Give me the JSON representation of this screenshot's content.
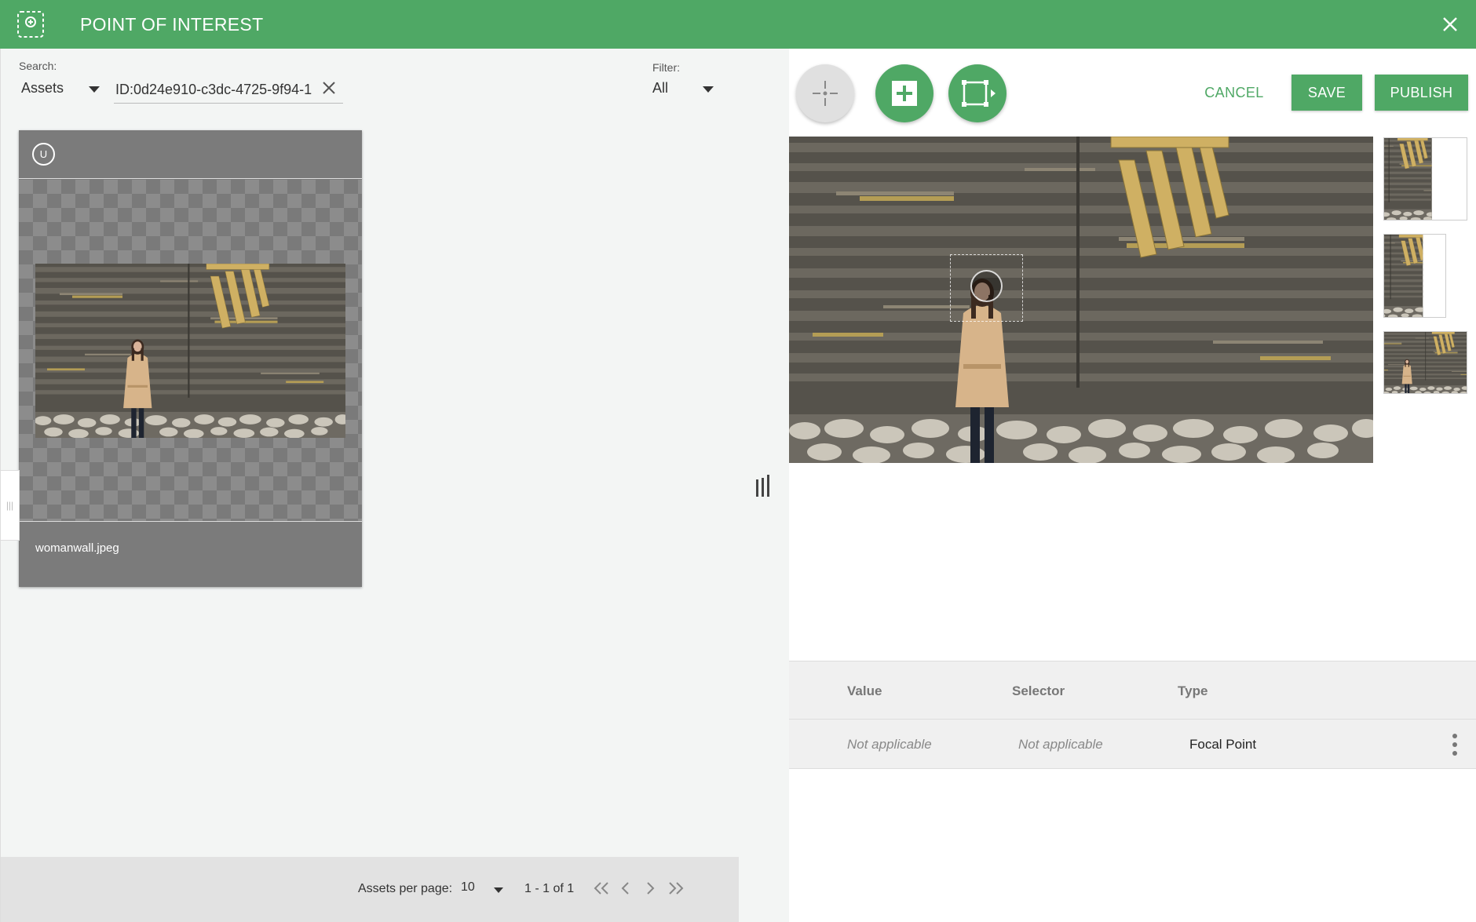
{
  "header": {
    "title": "POINT OF INTEREST",
    "brand_color": "#4fa865"
  },
  "search": {
    "label": "Search:",
    "scope": "Assets",
    "query": "ID:0d24e910-c3dc-4725-9f94-1",
    "filter_label": "Filter:",
    "filter_value": "All"
  },
  "asset_card": {
    "badge": "U",
    "filename": "womanwall.jpeg"
  },
  "pagination": {
    "per_page_label": "Assets per page:",
    "per_page_value": "10",
    "range": "1 - 1 of 1"
  },
  "toolbar": {
    "focal_icon": "crosshair-icon",
    "add_icon": "plus-icon",
    "crop_icon": "crop-frame-icon",
    "cancel_label": "CANCEL",
    "save_label": "SAVE",
    "publish_label": "PUBLISH"
  },
  "table": {
    "columns": [
      "Value",
      "Selector",
      "Type"
    ],
    "rows": [
      {
        "value": "Not applicable",
        "selector": "Not applicable",
        "type": "Focal Point"
      }
    ]
  }
}
